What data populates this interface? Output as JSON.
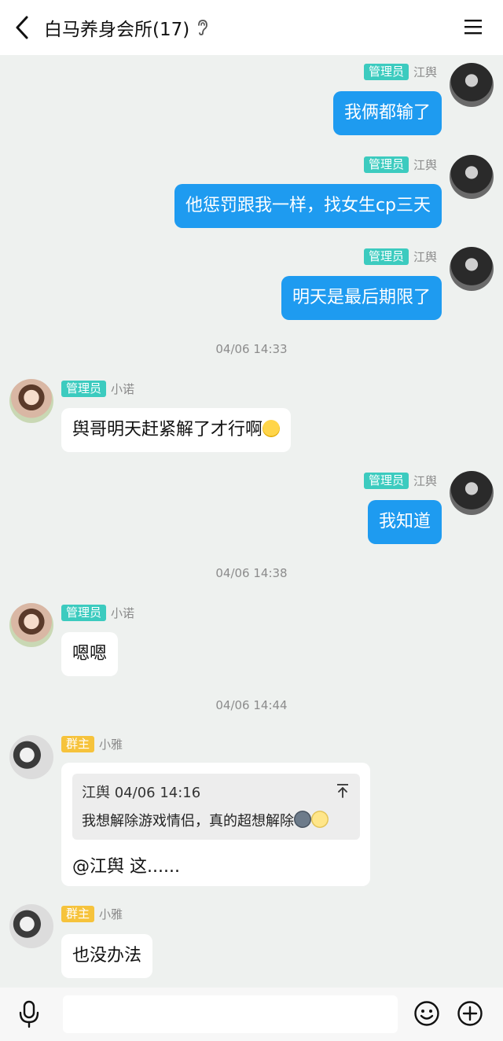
{
  "header": {
    "title": "白马养身会所(17)"
  },
  "messages": [
    {
      "side": "right",
      "badge": "管理员",
      "name": "江舆",
      "text": "我俩都输了"
    },
    {
      "side": "right",
      "badge": "管理员",
      "name": "江舆",
      "text": "他惩罚跟我一样，找女生cp三天"
    },
    {
      "side": "right",
      "badge": "管理员",
      "name": "江舆",
      "text": "明天是最后期限了"
    },
    {
      "time": "04/06 14:33"
    },
    {
      "side": "left",
      "badge": "管理员",
      "name": "小诺",
      "text": "舆哥明天赶紧解了才行啊"
    },
    {
      "side": "right",
      "badge": "管理员",
      "name": "江舆",
      "text": "我知道"
    },
    {
      "time": "04/06 14:38"
    },
    {
      "side": "left",
      "badge": "管理员",
      "name": "小诺",
      "text": "嗯嗯"
    },
    {
      "time": "04/06 14:44"
    },
    {
      "side": "left",
      "badge": "群主",
      "name": "小雅",
      "quote": {
        "author": "江舆 04/06 14:16",
        "text": "我想解除游戏情侣，真的超想解除"
      },
      "text": "@江舆 这......"
    },
    {
      "side": "left",
      "badge": "群主",
      "name": "小雅",
      "text": "也没办法"
    }
  ],
  "input": {
    "placeholder": ""
  },
  "colors": {
    "my_bubble": "#1e9bf0",
    "admin_badge": "#3ccbbf",
    "owner_badge": "#f6c33c",
    "background": "#eef1ef"
  },
  "icons": [
    "back-arrow-icon",
    "ear-icon",
    "menu-icon",
    "mic-icon",
    "emoji-icon",
    "plus-icon",
    "quote-jump-icon"
  ]
}
